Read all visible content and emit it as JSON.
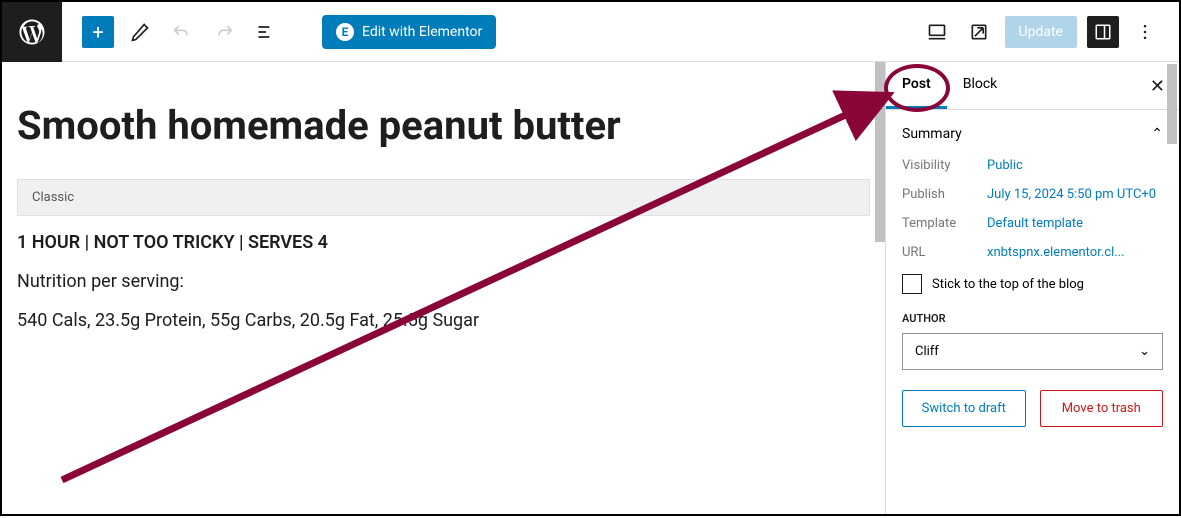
{
  "toolbar": {
    "elementor_label": "Edit with Elementor",
    "update_label": "Update"
  },
  "content": {
    "title": "Smooth homemade peanut butter",
    "block_type": "Classic",
    "line1": "1 HOUR | NOT TOO TRICKY | SERVES 4",
    "line2": "Nutrition per serving:",
    "line3": "540 Cals, 23.5g Protein, 55g Carbs, 20.5g Fat, 25.5g Sugar"
  },
  "sidebar": {
    "tabs": {
      "post": "Post",
      "block": "Block"
    },
    "panel_title": "Summary",
    "visibility": {
      "label": "Visibility",
      "value": "Public"
    },
    "publish": {
      "label": "Publish",
      "value": "July 15, 2024 5:50 pm UTC+0"
    },
    "template": {
      "label": "Template",
      "value": "Default template"
    },
    "url": {
      "label": "URL",
      "value": "xnbtspnx.elementor.cl..."
    },
    "stick_label": "Stick to the top of the blog",
    "author_label": "AUTHOR",
    "author_value": "Cliff",
    "switch_draft": "Switch to draft",
    "move_trash": "Move to trash"
  }
}
